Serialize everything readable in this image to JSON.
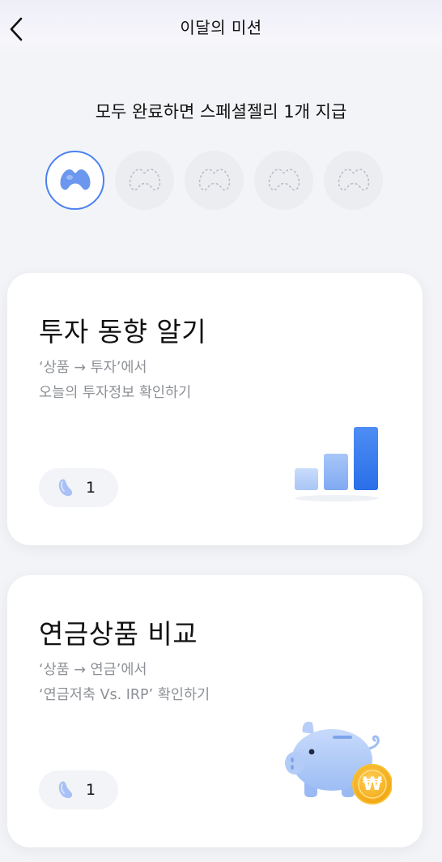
{
  "header": {
    "title": "이달의 미션"
  },
  "summary": {
    "text": "모두 완료하면 스페셜젤리 1개 지급"
  },
  "progress": {
    "completed": 1,
    "total": 5
  },
  "missions": [
    {
      "title": "투자 동향 알기",
      "desc_line1": "‘상품 → 투자’에서",
      "desc_line2": "오늘의 투자정보 확인하기",
      "reward_count": "1",
      "illustration": "bar-chart-icon"
    },
    {
      "title": "연금상품 비교",
      "desc_line1": "‘상품 → 연금’에서",
      "desc_line2": "‘연금저축 Vs. IRP’ 확인하기",
      "reward_count": "1",
      "illustration": "piggy-bank-icon",
      "coin_symbol": "₩"
    }
  ],
  "colors": {
    "accent": "#3d7cf0",
    "jelly": "#a8c0f5"
  }
}
